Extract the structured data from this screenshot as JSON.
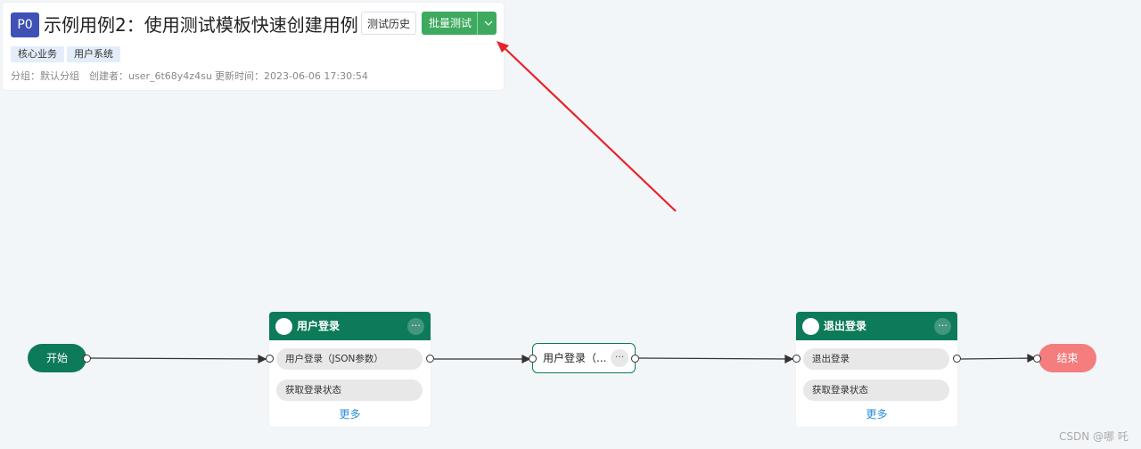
{
  "header": {
    "priority": "P0",
    "title": "示例用例2：使用测试模板快速创建用例",
    "history_button": "测试历史",
    "batch_button": "批量测试",
    "tags": [
      "核心业务",
      "用户系统"
    ],
    "group": "分组：默认分组",
    "creator": "创建者：user_6t68y4z4su",
    "updated": "更新时间：2023-06-06 17:30:54",
    "priority_color": "#3f51b5",
    "accent_color": "#3daa5f"
  },
  "flow": {
    "start_label": "开始",
    "end_label": "结束",
    "node_color": "#0d7a5a",
    "end_color": "#f47d7d",
    "node_login": {
      "title": "用户登录",
      "steps": [
        "用户登录（JSON参数）",
        "获取登录状态"
      ],
      "more": "更多"
    },
    "node_middle": {
      "label": "用户登录（..."
    },
    "node_logout": {
      "title": "退出登录",
      "steps": [
        "退出登录",
        "获取登录状态"
      ],
      "more": "更多"
    },
    "menu_glyph": "···"
  },
  "watermark": "CSDN @哪 吒"
}
